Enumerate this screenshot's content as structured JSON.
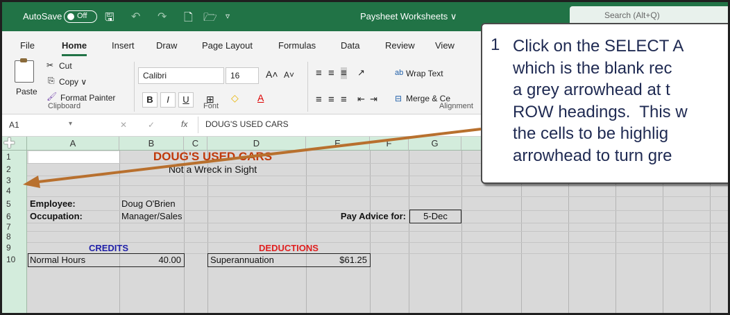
{
  "titlebar": {
    "autosave_label": "AutoSave",
    "autosave_state": "Off",
    "document_title": "Paysheet Worksheets ∨",
    "search_placeholder": "Search (Alt+Q)"
  },
  "tabs": [
    "File",
    "Home",
    "Insert",
    "Draw",
    "Page Layout",
    "Formulas",
    "Data",
    "Review",
    "View"
  ],
  "ribbon": {
    "paste": "Paste",
    "cut": "Cut",
    "copy": "Copy ∨",
    "format_painter": "Format Painter",
    "clipboard_group": "Clipboard",
    "font_name": "Calibri",
    "font_size": "16",
    "bold": "B",
    "italic": "I",
    "underline": "U",
    "font_group": "Font",
    "wrap_text": "Wrap Text",
    "merge_center": "Merge & Ce",
    "alignment_group": "Alignment"
  },
  "formula_bar": {
    "name_box": "A1",
    "fx": "fx",
    "content": "DOUG'S USED CARS"
  },
  "grid": {
    "columns": [
      "A",
      "B",
      "C",
      "D",
      "E",
      "F",
      "G"
    ],
    "rows": [
      "1",
      "2",
      "3",
      "4",
      "5",
      "6",
      "7",
      "8",
      "9",
      "10"
    ],
    "title": "DOUG'S USED CARS",
    "subtitle": "Not a Wreck in Sight",
    "employee_label": "Employee:",
    "employee_value": "Doug O'Brien",
    "occupation_label": "Occupation:",
    "occupation_value": "Manager/Sales",
    "pay_advice_label": "Pay Advice for:",
    "pay_advice_value": "5-Dec",
    "credits_header": "CREDITS",
    "deductions_header": "DEDUCTIONS",
    "normal_hours_label": "Normal Hours",
    "normal_hours_value": "40.00",
    "superannuation_label": "Superannuation",
    "superannuation_value": "$61.25"
  },
  "callout": {
    "number": "1",
    "text": "Click on the SELECT A\nwhich is the blank rec\na grey arrowhead at t\nROW headings.  This w\nthe cells to be highlig\narrowhead to turn gre"
  },
  "colors": {
    "excel_green": "#217346",
    "title_red": "#c0390b",
    "credits_blue": "#1f1fa8",
    "deductions_red": "#e02020",
    "arrow": "#b8702e",
    "callout_text": "#1f2a52"
  }
}
